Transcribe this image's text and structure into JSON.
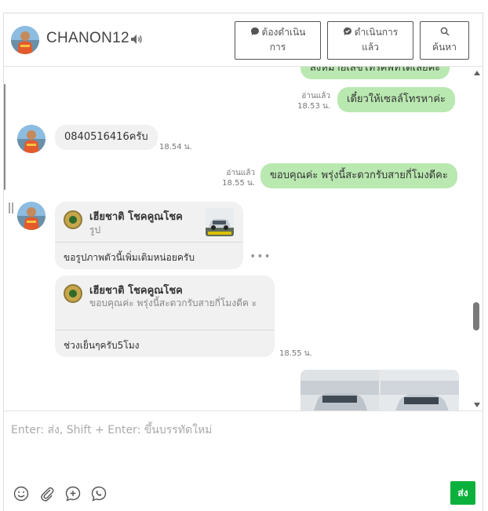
{
  "header": {
    "contact_name": "CHANON12",
    "buttons": [
      {
        "line1": "ต้องดำเนิน",
        "line2": "การ",
        "icon": "chat-bubble-icon"
      },
      {
        "line1": "ดำเนินการ",
        "line2": "แล้ว",
        "icon": "check-bubble-icon"
      },
      {
        "line1": "",
        "line2": "ค้นหา",
        "icon": "search-icon"
      }
    ]
  },
  "messages": {
    "m0": {
      "text": "ส่งหมายเลขโทรศัพท์ได้เลยค่ะ"
    },
    "m1": {
      "text": "เดี๋ยวให้เซลล์โทรหาค่ะ",
      "read": "อ่านแล้ว",
      "time": "18.53 น."
    },
    "m2": {
      "text": "0840516416ครับ",
      "time": "18.54 น."
    },
    "m3": {
      "text": "ขอบคุณค่ะ พรุ่งนี้สะดวกรับสายกี่โมงดีคะ",
      "read": "อ่านแล้ว",
      "time": "18.55 น."
    },
    "m4": {
      "reply_name": "เฮียชาติ โชคคูณโชค",
      "reply_sub": "รูป",
      "text": "ขอรูปภาพตัวนี้เพิ่มเติมหน่อยครับ"
    },
    "m5": {
      "reply_name": "เฮียชาติ โชคคูณโชค",
      "reply_sub": "ขอบคุณค่ะ พรุ่งนี้สะดวกรับสายกี่โมงดีค ะ",
      "text": "ช่วงเย็นๆครับ5โมง",
      "time": "18.55 น."
    }
  },
  "composer": {
    "placeholder": "Enter: ส่ง, Shift + Enter: ขึ้นบรรทัดใหม่",
    "send_label": "ส่ง",
    "tools": [
      "emoji-icon",
      "attachment-icon",
      "sticker-icon",
      "line-icon"
    ]
  },
  "colors": {
    "outgoing_bubble": "#b9e8b0",
    "incoming_bubble": "#f1f1f1",
    "send_button": "#0bb13c"
  }
}
